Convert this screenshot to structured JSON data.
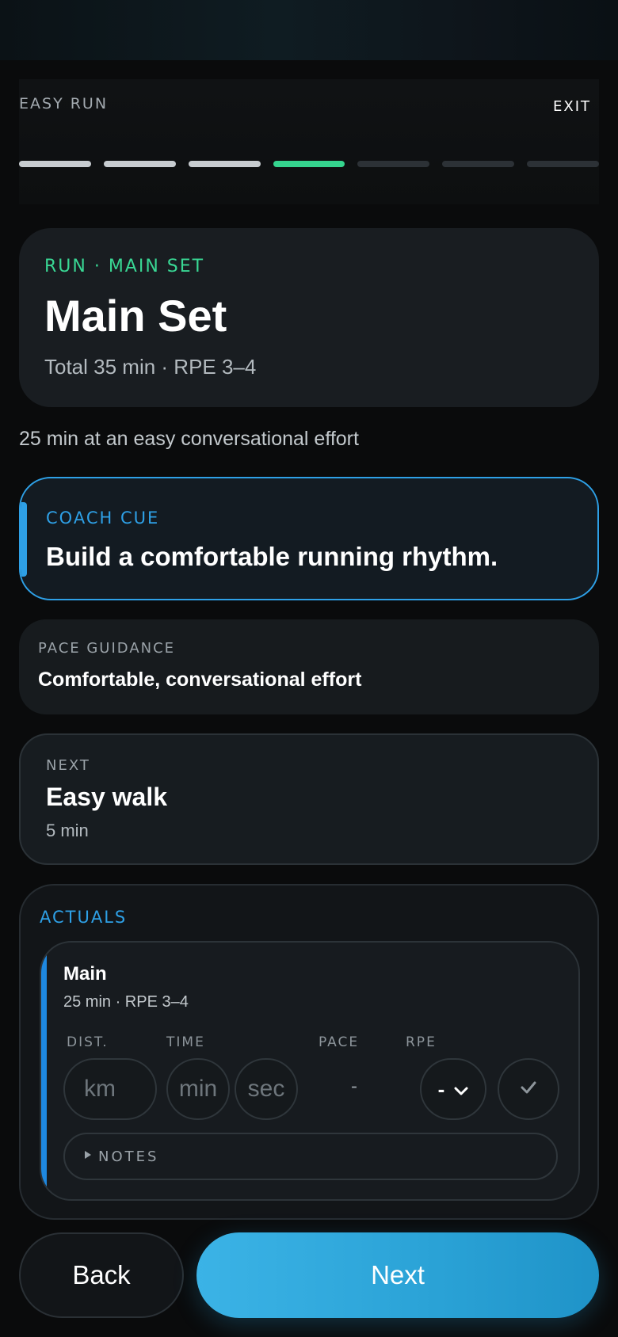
{
  "header": {
    "workout_name": "EASY RUN",
    "exit_label": "EXIT",
    "progress": {
      "total_steps": 7,
      "completed_steps": 3,
      "current_step": 4
    }
  },
  "step": {
    "kicker": "RUN · MAIN SET",
    "title": "Main Set",
    "meta": "Total 35 min · RPE 3–4",
    "description": "25 min at an easy conversational effort"
  },
  "coach_cue": {
    "label": "COACH CUE",
    "text": "Build a comfortable running rhythm."
  },
  "pace_guidance": {
    "label": "PACE GUIDANCE",
    "text": "Comfortable, conversational effort"
  },
  "next_step": {
    "label": "NEXT",
    "title": "Easy walk",
    "duration": "5 min"
  },
  "actuals": {
    "label": "ACTUALS",
    "entry": {
      "name": "Main",
      "sub": "25 min · RPE 3–4",
      "columns": {
        "dist": "DIST.",
        "time": "TIME",
        "pace": "PACE",
        "rpe": "RPE"
      },
      "dist_placeholder": "km",
      "min_placeholder": "min",
      "sec_placeholder": "sec",
      "pace_value": "-",
      "rpe_value": "-",
      "notes_label": "NOTES"
    }
  },
  "footer": {
    "back_label": "Back",
    "next_label": "Next"
  },
  "colors": {
    "accent_blue": "#2ea0e6",
    "accent_green": "#35d48e",
    "background": "#0a0b0c"
  }
}
